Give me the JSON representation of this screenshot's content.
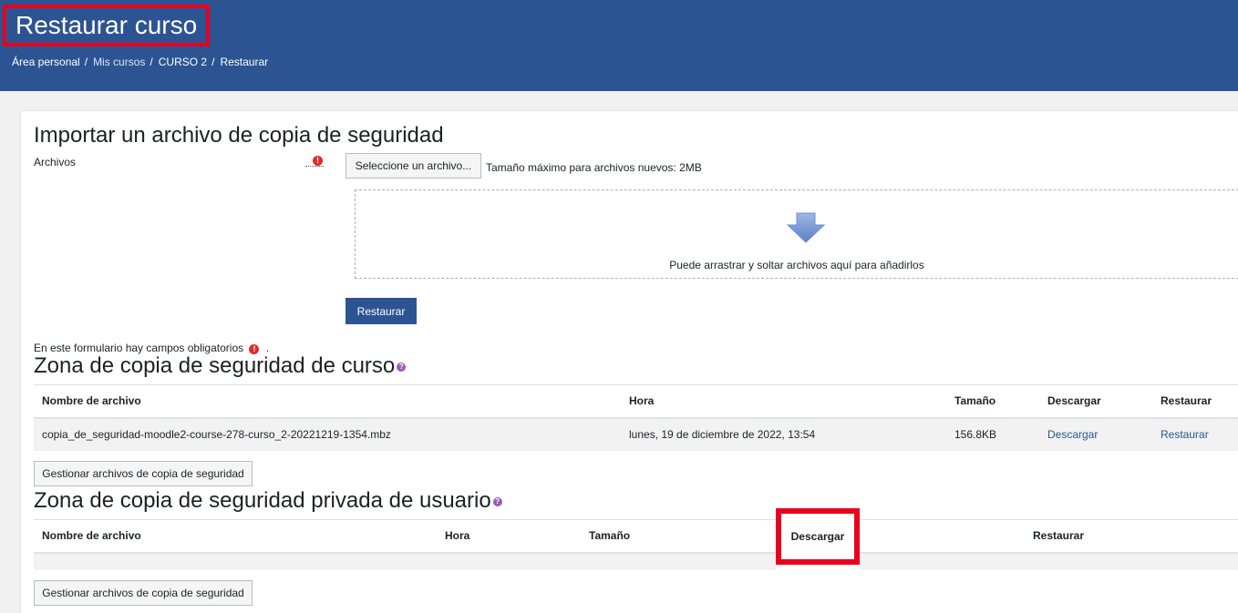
{
  "header": {
    "title": "Restaurar curso",
    "breadcrumb": [
      "Área personal",
      "Mis cursos",
      "CURSO 2",
      "Restaurar"
    ]
  },
  "import": {
    "heading": "Importar un archivo de copia de seguridad",
    "files_label": "Archivos",
    "choose_button": "Seleccione un archivo...",
    "max_size": "Tamaño máximo para archivos nuevos: 2MB",
    "dropzone_text": "Puede arrastrar y soltar archivos aquí para añadirlos",
    "restore_button": "Restaurar",
    "required_note": "En este formulario hay campos obligatorios",
    "required_note_suffix": "."
  },
  "course_zone": {
    "heading": "Zona de copia de seguridad de curso",
    "columns": [
      "Nombre de archivo",
      "Hora",
      "Tamaño",
      "Descargar",
      "Restaurar"
    ],
    "rows": [
      {
        "filename": "copia_de_seguridad-moodle2-course-278-curso_2-20221219-1354.mbz",
        "time": "lunes, 19 de diciembre de 2022, 13:54",
        "size": "156.8KB",
        "download": "Descargar",
        "restore": "Restaurar"
      }
    ],
    "manage_button": "Gestionar archivos de copia de seguridad"
  },
  "user_zone": {
    "heading": "Zona de copia de seguridad privada de usuario",
    "columns": [
      "Nombre de archivo",
      "Hora",
      "Tamaño",
      "Descargar",
      "Restaurar"
    ],
    "manage_button": "Gestionar archivos de copia de seguridad"
  },
  "colors": {
    "header_bg": "#2c5493",
    "highlight": "#e8001d",
    "link": "#2c5493"
  }
}
